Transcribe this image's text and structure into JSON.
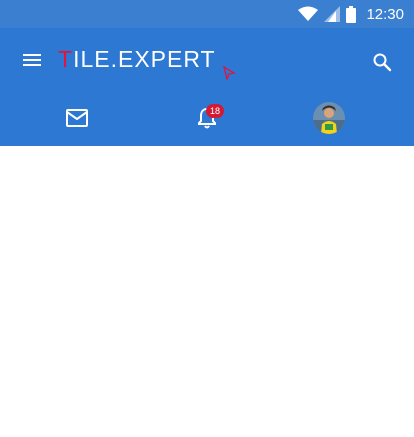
{
  "status_bar": {
    "time": "12:30",
    "icons": [
      "wifi-icon",
      "cell-signal-icon",
      "battery-icon"
    ]
  },
  "app_bar": {
    "logo_first_letter": "T",
    "logo_rest": "ILE.EXPERT",
    "menu_icon": "menu-icon",
    "search_icon": "search-icon"
  },
  "nav": {
    "mail_icon": "mail-icon",
    "notifications_icon": "bell-icon",
    "notifications_badge": "18",
    "avatar_icon": "avatar"
  },
  "colors": {
    "status_bar": "#3a7fd0",
    "app_bar": "#2d78d3",
    "logo_accent": "#e0143c",
    "badge": "#d21a35",
    "content_bg": "#ffffff"
  }
}
